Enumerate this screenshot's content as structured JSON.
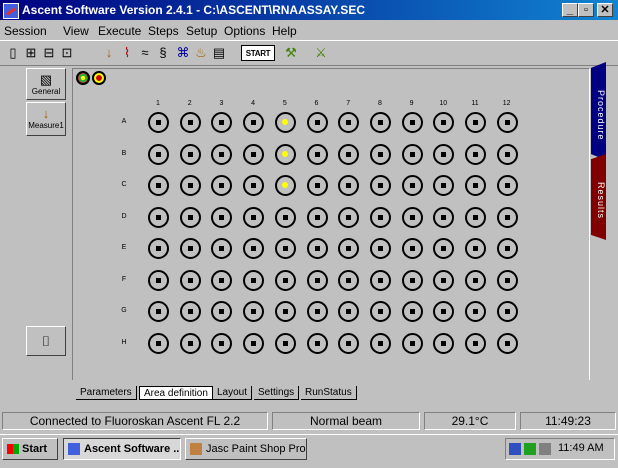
{
  "window": {
    "title": "Ascent Software Version 2.4.1      - C:\\ASCENT\\RNAASSAY.SEC",
    "minimize_label": "_",
    "maximize_label": "▫",
    "close_label": "✕"
  },
  "menu": {
    "items": [
      "Session",
      "View",
      "Execute",
      "Steps",
      "Setup",
      "Options",
      "Help"
    ]
  },
  "toolbar": {
    "start_label": "START"
  },
  "sidebar": {
    "items": [
      {
        "label": "General",
        "icon": "general-icon"
      },
      {
        "label": "Measure1",
        "icon": "measure-icon"
      }
    ]
  },
  "plate": {
    "columns": [
      "1",
      "2",
      "3",
      "4",
      "5",
      "6",
      "7",
      "8",
      "9",
      "10",
      "11",
      "12"
    ],
    "rows": [
      "A",
      "B",
      "C",
      "D",
      "E",
      "F",
      "G",
      "H"
    ],
    "selected_wells": [
      "A5",
      "B5",
      "C5"
    ],
    "selected_color": "#ffff00"
  },
  "right_tabs": [
    {
      "label": "Procedure",
      "color": "#000080"
    },
    {
      "label": "Results",
      "color": "#800000"
    }
  ],
  "tabs": [
    "Parameters",
    "Area definition",
    "Layout",
    "Settings",
    "RunStatus"
  ],
  "active_tab": "Area definition",
  "status": {
    "connection": "Connected to Fluoroskan Ascent FL 2.2",
    "beam": "Normal beam",
    "temperature": "29.1°C",
    "time": "11:49:23"
  },
  "taskbar": {
    "start_label": "Start",
    "buttons": [
      "Ascent Software ...",
      "Jasc Paint Shop Pro..."
    ],
    "clock": "11:49 AM"
  }
}
